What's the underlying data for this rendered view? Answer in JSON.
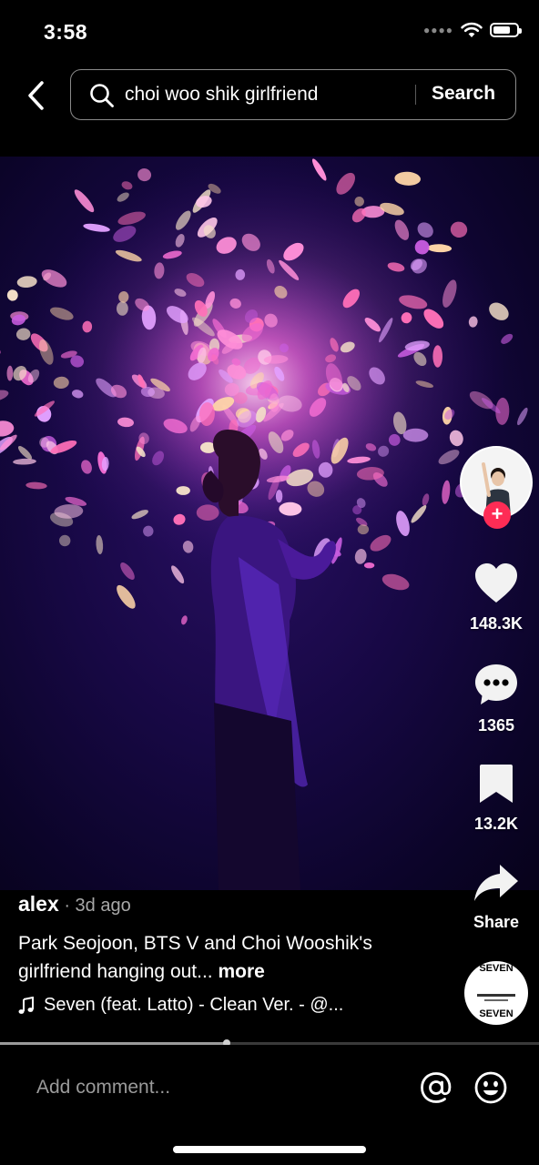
{
  "status": {
    "time": "3:58"
  },
  "search": {
    "query": "choi woo shik girlfriend",
    "button_label": "Search"
  },
  "actions": {
    "likes": "148.3K",
    "comments": "1365",
    "bookmarks": "13.2K",
    "share_label": "Share"
  },
  "post": {
    "username": "alex",
    "posted": " · 3d ago",
    "description": "Park Seojoon, BTS V and Choi Wooshik's girlfriend hanging out... ",
    "more_label": "more",
    "music": "Seven (feat. Latto) - Clean Ver. - @..."
  },
  "music_disc": {
    "title_top": "SEVEN",
    "title_bottom": "SEVEN"
  },
  "playback": {
    "progress_fraction": 0.42
  },
  "comment": {
    "placeholder": "Add comment..."
  },
  "colors": {
    "follow": "#fe2c55",
    "background": "#000000"
  }
}
